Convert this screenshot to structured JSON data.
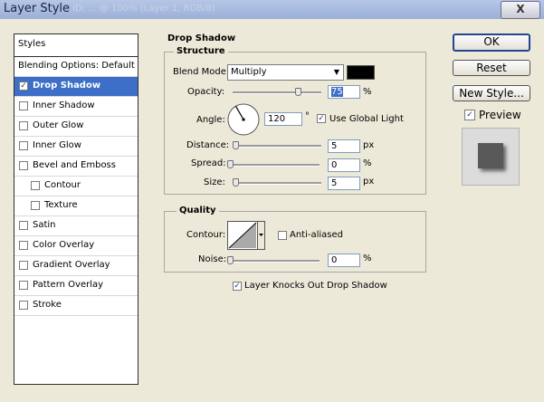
{
  "window": {
    "title": "Layer Style",
    "ghost_text": "ID: ... @ 100% (Layer 1, RGB/8)",
    "close": "X"
  },
  "sidebar": {
    "header": "Styles",
    "items": [
      {
        "label": "Blending Options: Default",
        "checkbox": false,
        "checked": false,
        "selected": false,
        "indent": 0
      },
      {
        "label": "Drop Shadow",
        "checkbox": true,
        "checked": true,
        "selected": true,
        "indent": 0
      },
      {
        "label": "Inner Shadow",
        "checkbox": true,
        "checked": false,
        "selected": false,
        "indent": 0
      },
      {
        "label": "Outer Glow",
        "checkbox": true,
        "checked": false,
        "selected": false,
        "indent": 0
      },
      {
        "label": "Inner Glow",
        "checkbox": true,
        "checked": false,
        "selected": false,
        "indent": 0
      },
      {
        "label": "Bevel and Emboss",
        "checkbox": true,
        "checked": false,
        "selected": false,
        "indent": 0
      },
      {
        "label": "Contour",
        "checkbox": true,
        "checked": false,
        "selected": false,
        "indent": 1
      },
      {
        "label": "Texture",
        "checkbox": true,
        "checked": false,
        "selected": false,
        "indent": 1
      },
      {
        "label": "Satin",
        "checkbox": true,
        "checked": false,
        "selected": false,
        "indent": 0
      },
      {
        "label": "Color Overlay",
        "checkbox": true,
        "checked": false,
        "selected": false,
        "indent": 0
      },
      {
        "label": "Gradient Overlay",
        "checkbox": true,
        "checked": false,
        "selected": false,
        "indent": 0
      },
      {
        "label": "Pattern Overlay",
        "checkbox": true,
        "checked": false,
        "selected": false,
        "indent": 0
      },
      {
        "label": "Stroke",
        "checkbox": true,
        "checked": false,
        "selected": false,
        "indent": 0
      }
    ]
  },
  "panel": {
    "title": "Drop Shadow",
    "structure": {
      "title": "Structure",
      "blend_mode_label": "Blend Mode:",
      "blend_mode_value": "Multiply",
      "shadow_color": "#000000",
      "opacity_label": "Opacity:",
      "opacity_value": "75",
      "opacity_unit": "%",
      "angle_label": "Angle:",
      "angle_value": "120",
      "angle_unit": "°",
      "use_global_light_label": "Use Global Light",
      "use_global_light_checked": true,
      "distance_label": "Distance:",
      "distance_value": "5",
      "distance_unit": "px",
      "spread_label": "Spread:",
      "spread_value": "0",
      "spread_unit": "%",
      "size_label": "Size:",
      "size_value": "5",
      "size_unit": "px"
    },
    "quality": {
      "title": "Quality",
      "contour_label": "Contour:",
      "anti_aliased_label": "Anti-aliased",
      "anti_aliased_checked": false,
      "noise_label": "Noise:",
      "noise_value": "0",
      "noise_unit": "%"
    },
    "knockout_label": "Layer Knocks Out Drop Shadow",
    "knockout_checked": true
  },
  "buttons": {
    "ok": "OK",
    "reset": "Reset",
    "new_style": "New Style...",
    "preview_label": "Preview",
    "preview_checked": true
  }
}
